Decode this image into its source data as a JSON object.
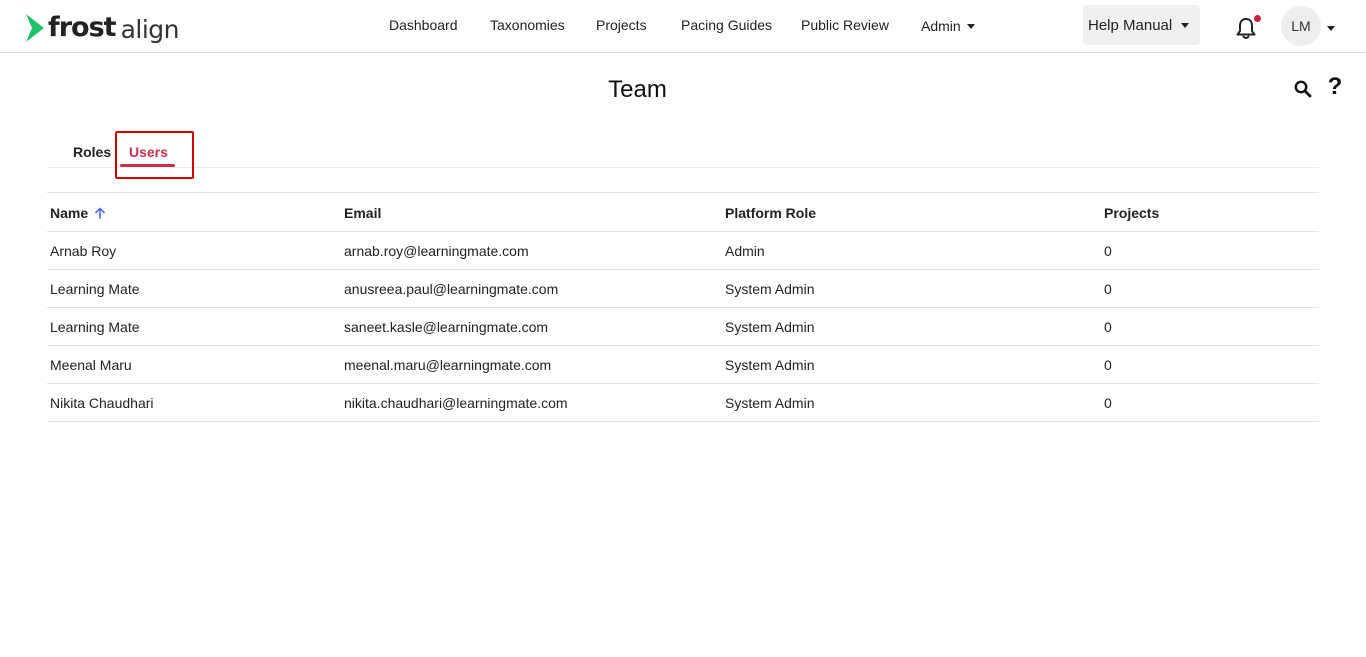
{
  "header": {
    "logo": {
      "brand_bold": "frost",
      "brand_light": "align",
      "accent_color": "#22c26a"
    },
    "nav": [
      {
        "label": "Dashboard"
      },
      {
        "label": "Taxonomies"
      },
      {
        "label": "Projects"
      },
      {
        "label": "Pacing Guides"
      },
      {
        "label": "Public Review"
      },
      {
        "label": "Admin"
      }
    ],
    "help_manual": "Help Manual",
    "notification_dot_color": "#d0213a",
    "avatar_initials": "LM",
    "icons": [
      "chevron-right-logo-icon",
      "bell-icon",
      "chevron-down-icon"
    ]
  },
  "page": {
    "title": "Team",
    "icons": [
      "search-icon",
      "help-icon"
    ],
    "tabs": [
      {
        "label": "Roles",
        "active": false
      },
      {
        "label": "Users",
        "active": true
      }
    ],
    "accent_color": "#c8314f"
  },
  "table": {
    "columns": [
      "Name",
      "Email",
      "Platform Role",
      "Projects"
    ],
    "sort": {
      "column": "Name",
      "direction": "ascending",
      "icon": "arrow-up-icon"
    },
    "rows": [
      {
        "name": "Arnab Roy",
        "email": "arnab.roy@learningmate.com",
        "role": "Admin",
        "projects": "0"
      },
      {
        "name": "Learning Mate",
        "email": "anusreea.paul@learningmate.com",
        "role": "System Admin",
        "projects": "0"
      },
      {
        "name": "Learning Mate",
        "email": "saneet.kasle@learningmate.com",
        "role": "System Admin",
        "projects": "0"
      },
      {
        "name": "Meenal Maru",
        "email": "meenal.maru@learningmate.com",
        "role": "System Admin",
        "projects": "0"
      },
      {
        "name": "Nikita Chaudhari",
        "email": "nikita.chaudhari@learningmate.com",
        "role": "System Admin",
        "projects": "0"
      }
    ]
  }
}
